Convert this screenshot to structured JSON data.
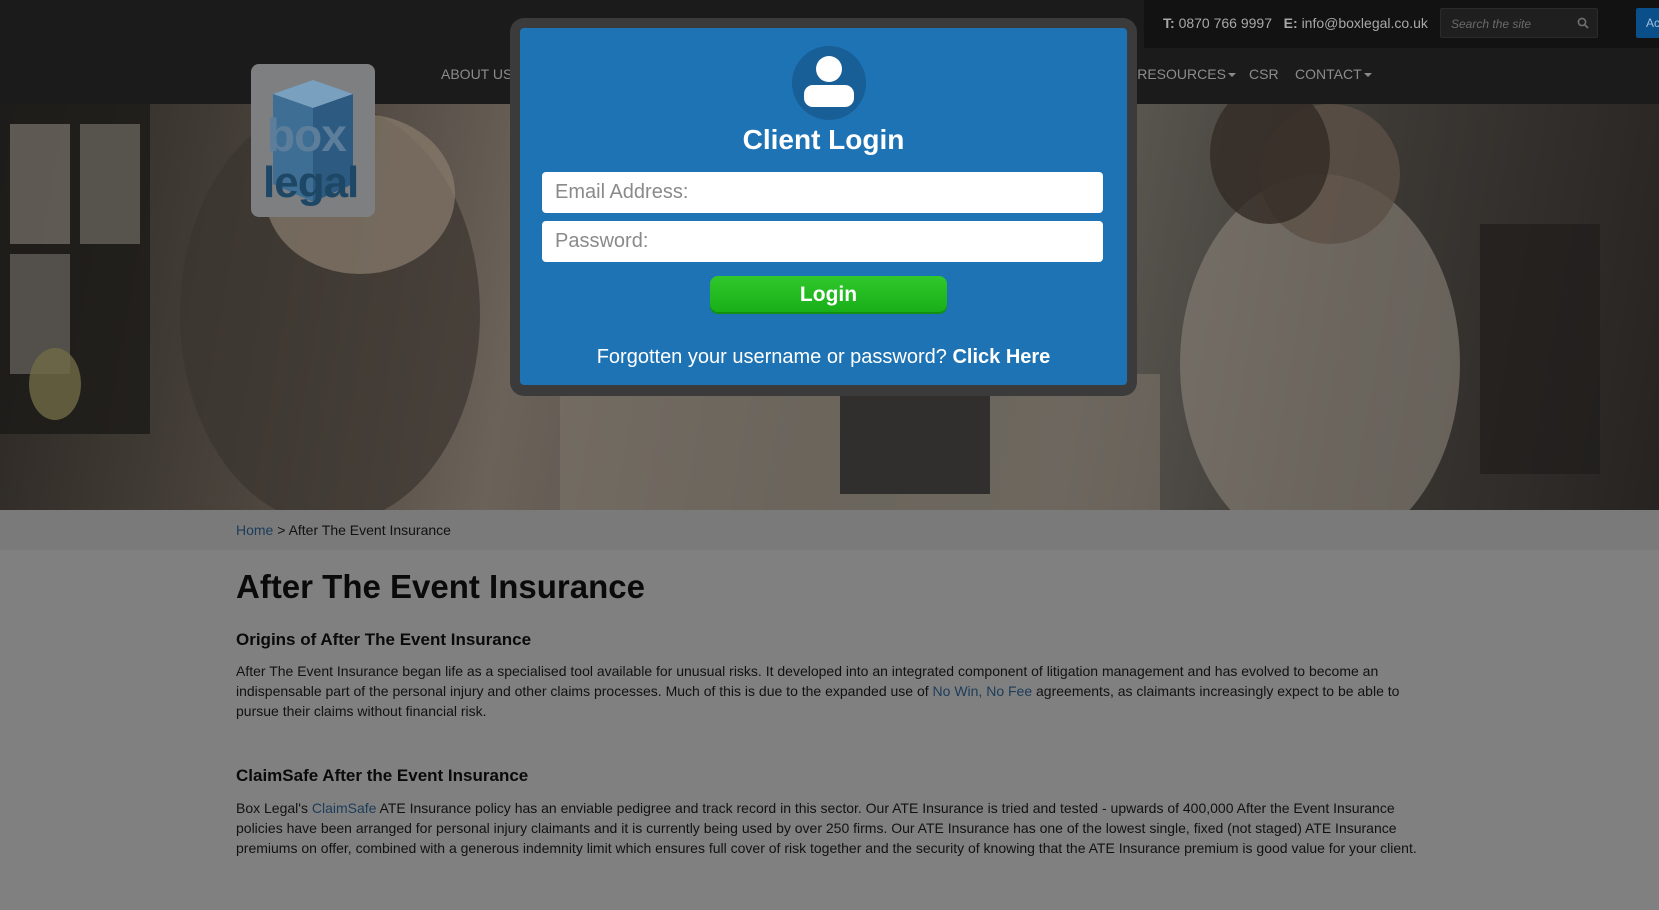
{
  "header": {
    "phone_label": "T:",
    "phone": "0870 766 9997",
    "email_label": "E:",
    "email": "info@boxlegal.co.uk",
    "search_placeholder": "Search the site",
    "account_button_label": "Ac"
  },
  "nav": {
    "items": [
      {
        "label": "ABOUT US",
        "has_dropdown": true
      },
      {
        "label": "E RESOURCES",
        "has_dropdown": true
      },
      {
        "label": "CSR",
        "has_dropdown": false
      },
      {
        "label": "CONTACT",
        "has_dropdown": true
      }
    ]
  },
  "logo": {
    "word1": "box",
    "word2": "legal"
  },
  "breadcrumb": {
    "home": "Home",
    "separator": ">",
    "current": "After The Event Insurance"
  },
  "article": {
    "title": "After The Event Insurance",
    "sections": [
      {
        "heading": "Origins of After The Event Insurance",
        "text_before": "After The Event Insurance began life as a specialised tool available for unusual risks. It developed into an integrated component of litigation management and has evolved to become an indispensable part of the personal injury and other claims processes. Much of this is due to the expanded use of ",
        "link": "No Win, No Fee",
        "text_after": " agreements, as claimants increasingly expect to be able to pursue their claims without financial risk."
      },
      {
        "heading": "ClaimSafe After the Event Insurance",
        "text_before": "Box Legal's ",
        "link": "ClaimSafe",
        "text_after": " ATE Insurance policy has an enviable pedigree and track record in this sector. Our ATE Insurance is tried and tested - upwards of 400,000 After the Event Insurance policies have been arranged for personal injury claimants and it is currently being used by over 250 firms. Our ATE Insurance has one of the lowest single, fixed (not staged) ATE Insurance premiums on offer, combined with a generous indemnity limit which ensures full cover of risk together and the security of knowing that the ATE Insurance premium is good value for your client."
      }
    ]
  },
  "login_modal": {
    "icon": "user-icon",
    "title": "Client Login",
    "email_placeholder": "Email Address:",
    "password_placeholder": "Password:",
    "login_button": "Login",
    "forgot_text": "Forgotten your username or password?",
    "forgot_link": "Click Here"
  },
  "colors": {
    "modal_blue": "#1e73b4",
    "login_green": "#1fba1f",
    "link_blue": "#1b3c5a",
    "overlay_gray": "#808080"
  }
}
